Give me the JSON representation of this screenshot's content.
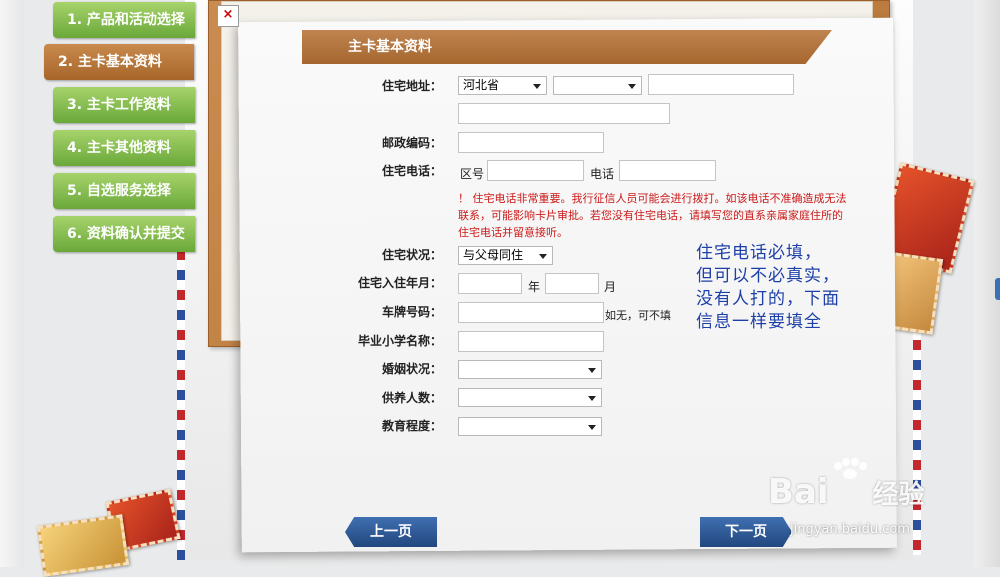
{
  "steps": [
    {
      "label": "1. 产品和活动选择"
    },
    {
      "label": "2. 主卡基本资料",
      "active": true
    },
    {
      "label": "3. 主卡工作资料"
    },
    {
      "label": "4. 主卡其他资料"
    },
    {
      "label": "5. 自选服务选择"
    },
    {
      "label": "6. 资料确认并提交"
    }
  ],
  "close_glyph": "×",
  "section_title": "主卡基本资料",
  "form": {
    "address": {
      "label": "住宅地址：",
      "province": "河北省",
      "city": "",
      "district": "",
      "detail": ""
    },
    "postcode": {
      "label": "邮政编码：",
      "value": ""
    },
    "phone": {
      "label": "住宅电话：",
      "area_label": "区号",
      "area_value": "",
      "number_label": "电话",
      "number_value": ""
    },
    "warning": "！ 住宅电话非常重要。我行征信人员可能会进行拨打。如该电话不准确造成无法联系，可能影响卡片审批。若您没有住宅电话，请填写您的直系亲属家庭住所的住宅电话并留意接听。",
    "residence_status": {
      "label": "住宅状况：",
      "value": "与父母同住"
    },
    "move_in": {
      "label": "住宅入住年月：",
      "year_value": "",
      "year_unit": "年",
      "month_value": "",
      "month_unit": "月"
    },
    "plate": {
      "label": "车牌号码：",
      "value": "",
      "hint": "如无，可不填"
    },
    "school": {
      "label": "毕业小学名称：",
      "value": ""
    },
    "marriage": {
      "label": "婚姻状况：",
      "value": ""
    },
    "dependents": {
      "label": "供养人数：",
      "value": ""
    },
    "education": {
      "label": "教育程度：",
      "value": ""
    }
  },
  "annotation": [
    "住宅电话必填，",
    "但可以不必真实，",
    "没有人打的，下面",
    "信息一样要填全"
  ],
  "nav": {
    "prev": "上一页",
    "next": "下一页"
  },
  "watermark": {
    "logo": "Bai",
    "logo_tail": "经验",
    "url": "jingyan.baidu.com"
  },
  "colors": {
    "step_green": "#7fb847",
    "step_active": "#b87538",
    "ribbon": "#b27039",
    "warning_red": "#cc1a1a",
    "note_blue": "#1d3fa8",
    "nav_blue": "#2f5c9c"
  }
}
